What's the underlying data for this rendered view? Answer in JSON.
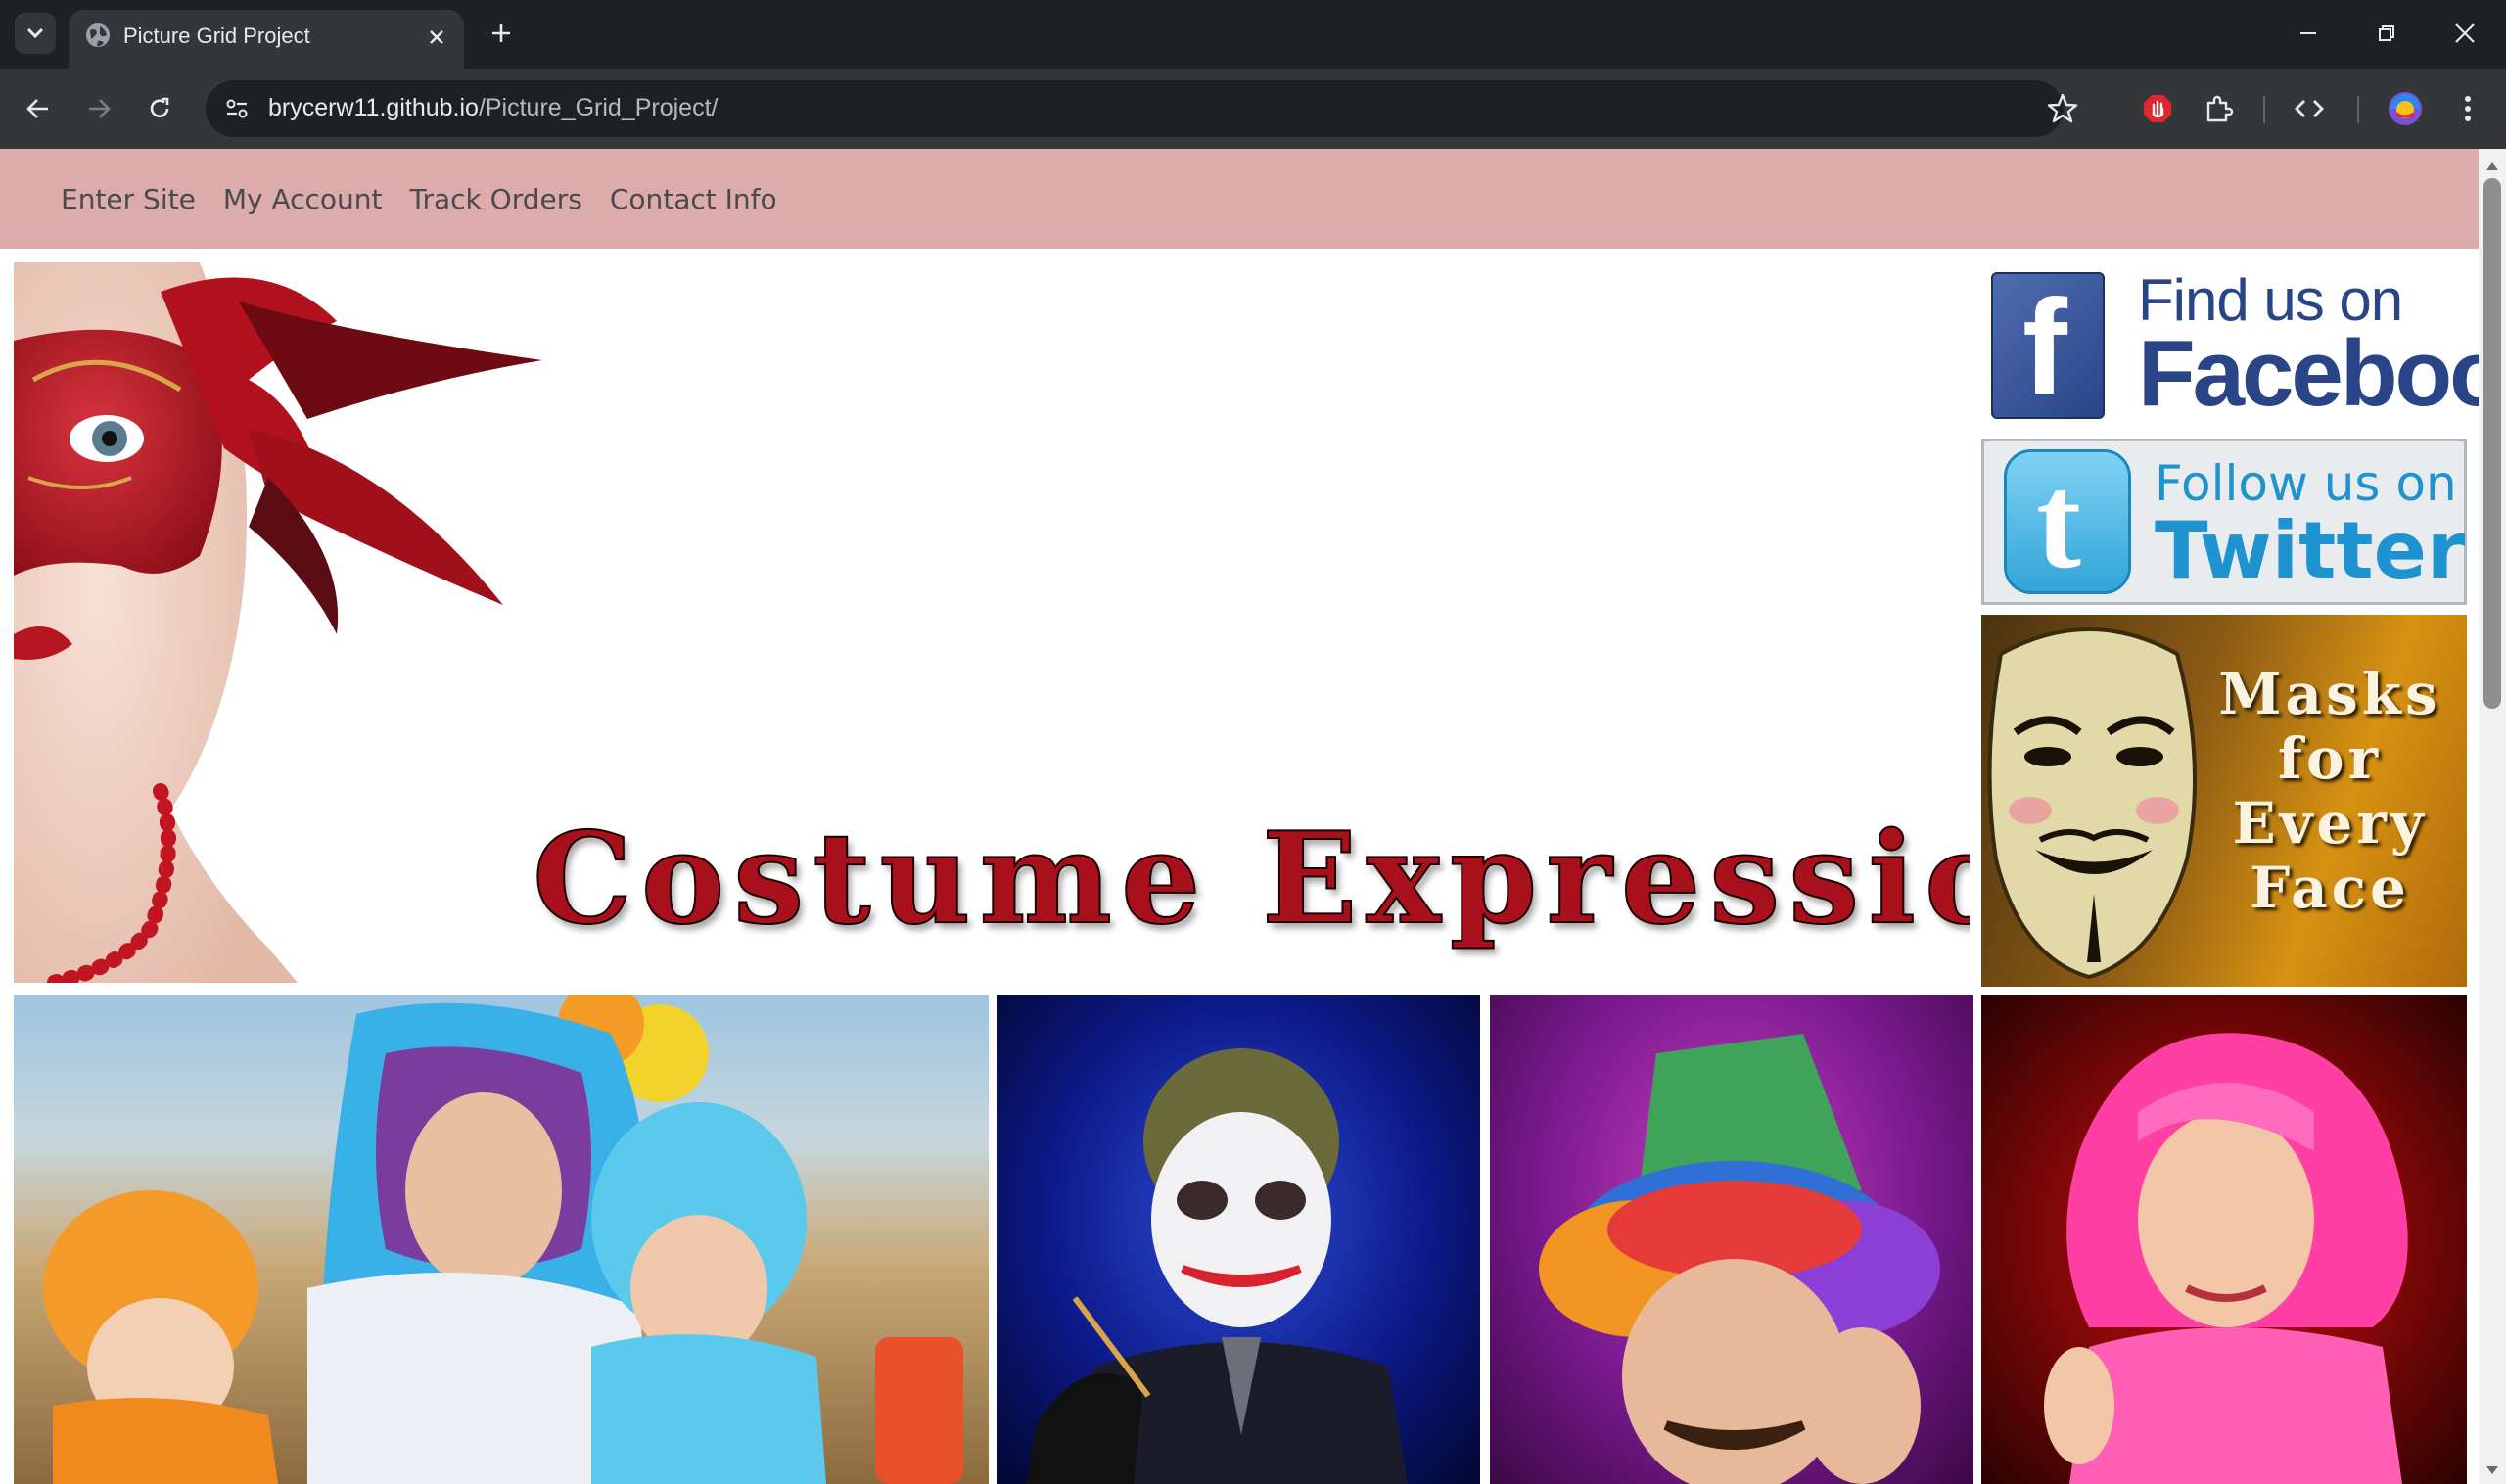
{
  "browser": {
    "tab_title": "Picture Grid Project",
    "url_host": "brycerw11.github.io",
    "url_path": "/Picture_Grid_Project/",
    "icons": [
      "tab-list-icon",
      "globe-icon",
      "close-icon",
      "plus-icon",
      "minimize-icon",
      "restore-icon",
      "window-close-icon",
      "back-icon",
      "forward-icon",
      "reload-icon",
      "site-info-icon",
      "star-icon",
      "adblock-icon",
      "extensions-icon",
      "devtools-icon",
      "profile-icon",
      "more-icon"
    ]
  },
  "nav": {
    "items": [
      "Enter Site",
      "My Account",
      "Track Orders",
      "Contact Info"
    ]
  },
  "hero": {
    "brand": "Costume Expressions"
  },
  "social": {
    "facebook_line1": "Find us on",
    "facebook_line2": "Facebook",
    "facebook_letter": "f",
    "twitter_line1": "Follow us on",
    "twitter_line2": "Twitter",
    "twitter_letter": "t"
  },
  "promo": {
    "lines": [
      "Masks",
      "for",
      "Every",
      "Face"
    ]
  },
  "colors": {
    "nav_bg": "#dcabab",
    "brand_red": "#a8101b",
    "facebook_blue": "#2a4587",
    "twitter_blue": "#1f93cf"
  }
}
